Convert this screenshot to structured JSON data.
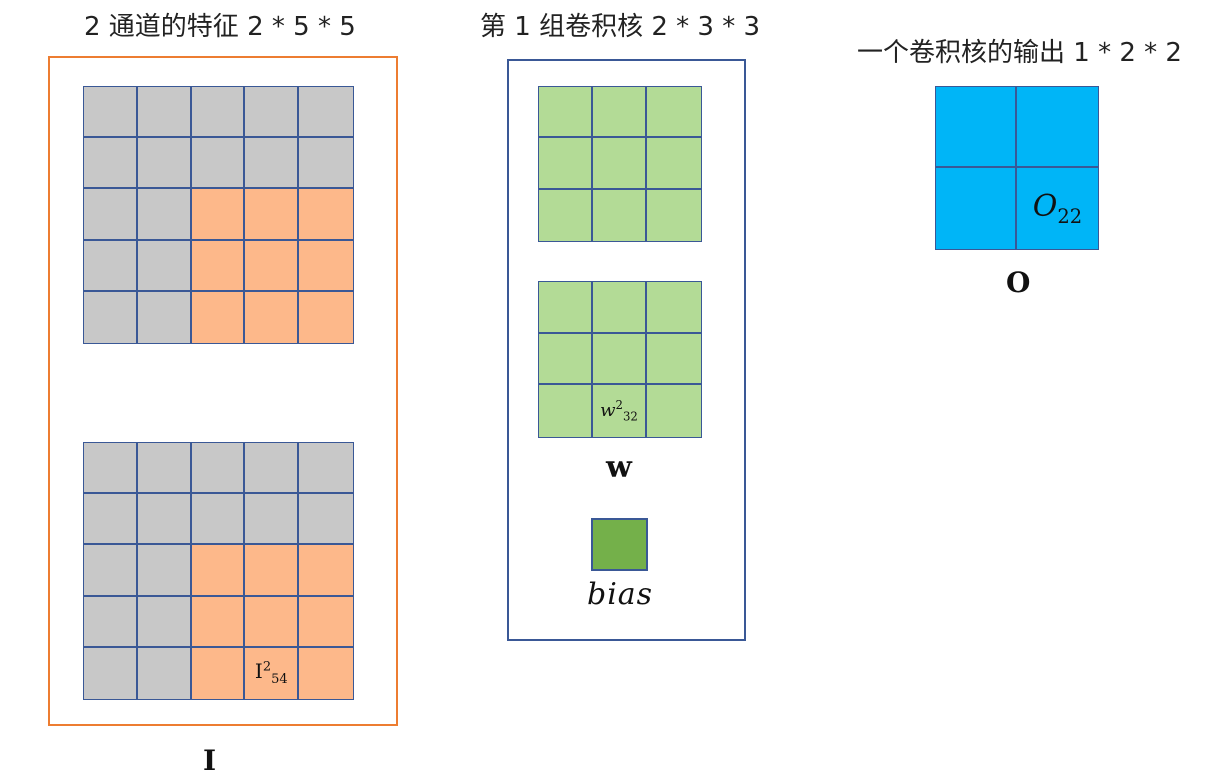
{
  "input_panel": {
    "title": "2 通道的特征 2 * 5 * 5",
    "label": "I",
    "channel2_cell_label": {
      "base": "I",
      "sup": "2",
      "sub": "54"
    }
  },
  "kernel_panel": {
    "title": "第 1 组卷积核 2 * 3 * 3",
    "label": "w",
    "channel2_cell_label": {
      "base": "w",
      "sup": "2",
      "sub": "32"
    },
    "bias_label": "bias"
  },
  "output_panel": {
    "title": "一个卷积核的输出 1 * 2 * 2",
    "label": "O",
    "cell_label": {
      "base": "O",
      "sub": "22"
    }
  },
  "colors": {
    "feature_cell": "#c8c8c8",
    "receptive_field": "#fdb88a",
    "kernel": "#b3db96",
    "bias": "#74b04a",
    "output": "#00b5f7",
    "grid_line": "#3a5896",
    "input_border": "#ed7d31",
    "kernel_border": "#3a5896"
  }
}
